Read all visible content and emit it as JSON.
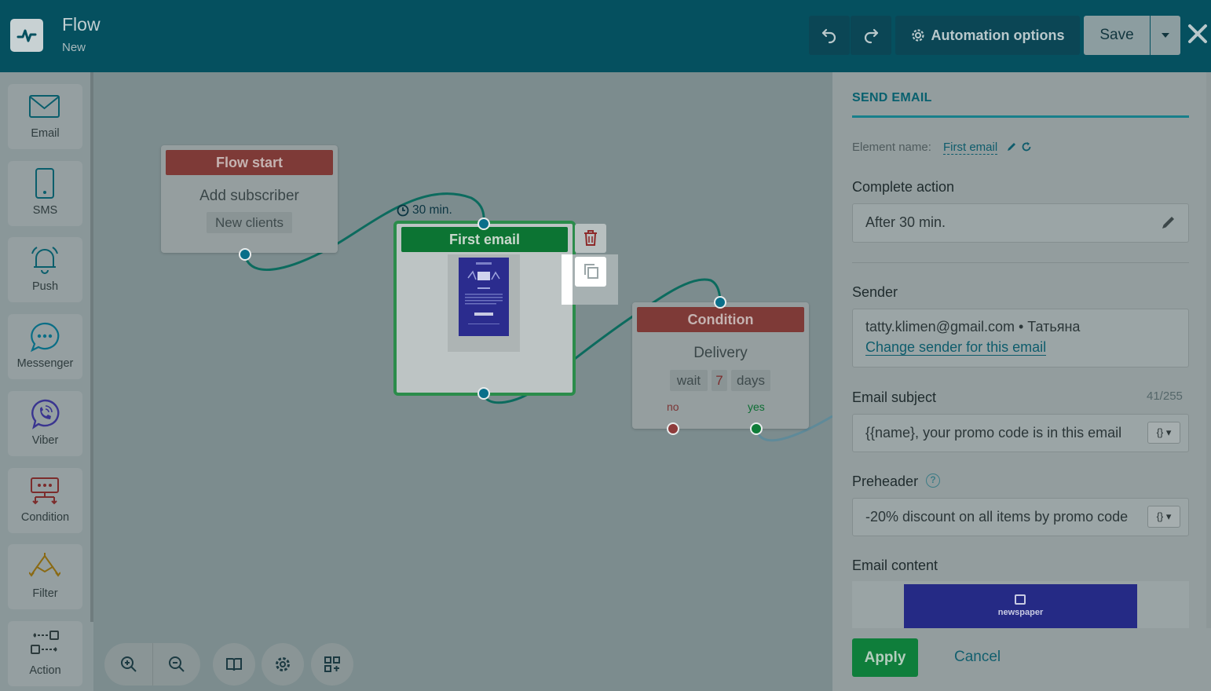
{
  "header": {
    "title": "Flow",
    "subtitle": "New",
    "automation_options_label": "Automation options",
    "save_label": "Save"
  },
  "sidebar": {
    "items": [
      {
        "label": "Email",
        "icon": "envelope-icon"
      },
      {
        "label": "SMS",
        "icon": "phone-icon"
      },
      {
        "label": "Push",
        "icon": "bell-icon"
      },
      {
        "label": "Messenger",
        "icon": "chat-bubble-icon"
      },
      {
        "label": "Viber",
        "icon": "viber-icon"
      },
      {
        "label": "Condition",
        "icon": "condition-icon"
      },
      {
        "label": "Filter",
        "icon": "filter-icon"
      },
      {
        "label": "Action",
        "icon": "action-icon"
      }
    ]
  },
  "canvas": {
    "flow_start": {
      "header": "Flow start",
      "title": "Add subscriber",
      "chip": "New clients"
    },
    "delay_label": "30 min.",
    "first_email": {
      "header": "First email"
    },
    "condition": {
      "header": "Condition",
      "title": "Delivery",
      "wait": "wait",
      "value": "7",
      "unit": "days",
      "no_label": "no",
      "yes_label": "yes"
    }
  },
  "panel": {
    "title": "SEND EMAIL",
    "element_name_label": "Element name:",
    "element_name_value": "First email",
    "complete_action_label": "Complete action",
    "complete_action_value": "After 30 min.",
    "sender_label": "Sender",
    "sender_value": "tatty.klimen@gmail.com • Татьяна",
    "change_sender_link": "Change sender for this email",
    "email_subject_label": "Email subject",
    "email_subject_counter": "41/255",
    "email_subject_value": "{{name}, your promo code is in this email",
    "preheader_label": "Preheader",
    "preheader_value": "-20% discount on all items by promo code",
    "email_content_label": "Email content",
    "newspaper_logo_text": "newspaper",
    "apply_label": "Apply",
    "cancel_label": "Cancel"
  },
  "colors": {
    "header_bg": "#05505f",
    "accent_teal": "#08606e",
    "node_red": "#7e3a37",
    "node_green": "#0c7433",
    "apply_green": "#0f7e3b"
  }
}
